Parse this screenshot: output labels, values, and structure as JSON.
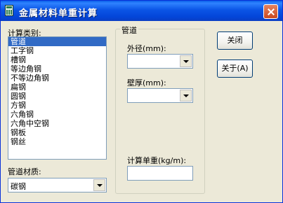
{
  "window": {
    "title": "金属材料单重计算"
  },
  "calc_type": {
    "label": "计算类别:",
    "items": [
      "管道",
      "工字钢",
      "槽钢",
      "等边角钢",
      "不等边角钢",
      "扁钢",
      "圆钢",
      "方钢",
      "六角钢",
      "六角中空钢",
      "钢板",
      "钢丝"
    ],
    "selected_index": 0
  },
  "material": {
    "label": "管道材质:",
    "value": "碳钢"
  },
  "group": {
    "legend": "管道",
    "outer_diameter_label": "外径(mm):",
    "outer_diameter_value": "",
    "wall_thickness_label": "壁厚(mm):",
    "wall_thickness_value": "",
    "unit_weight_label": "计算单重(kg/m):",
    "unit_weight_value": ""
  },
  "buttons": {
    "close": "关闭",
    "about": "关于(A)"
  }
}
